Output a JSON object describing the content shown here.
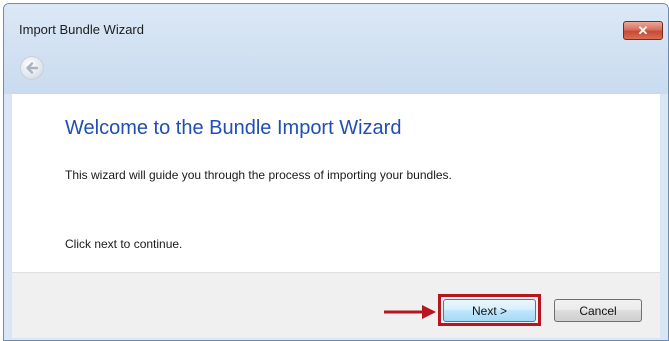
{
  "window": {
    "title": "Import Bundle Wizard"
  },
  "titlebar": {
    "close_icon": "close-icon",
    "close_glyph": "✕",
    "back_icon": "back-arrow-icon"
  },
  "content": {
    "heading": "Welcome to the Bundle Import Wizard",
    "description": "This wizard will guide you through the process of importing your bundles.",
    "hint": "Click next to continue."
  },
  "footer": {
    "next_label": "Next >",
    "cancel_label": "Cancel",
    "annotation_arrow_icon": "right-arrow-icon"
  },
  "colors": {
    "heading": "#1f4fb5",
    "annotation": "#b8161f",
    "close_button": "#c74a36"
  }
}
